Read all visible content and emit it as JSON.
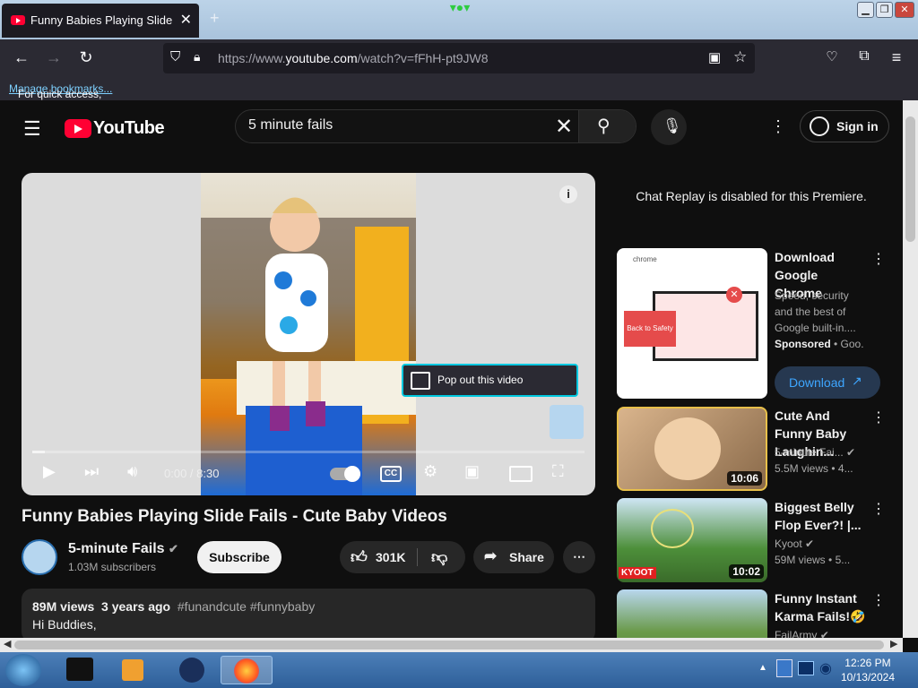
{
  "browser": {
    "tab_title": "Funny Babies Playing Slide Fails",
    "url_prefix": "https://www.",
    "url_domain": "youtube.com",
    "url_path": "/watch?v=fFhH-pt9JW8",
    "bookmarks_prompt": "For quick access, place your bookmarks here on the bookmarks toolbar.",
    "bookmarks_link": "Manage bookmarks..."
  },
  "youtube": {
    "logo_text": "YouTube",
    "search_value": "5 minute fails",
    "sign_in": "Sign in",
    "player": {
      "popout_label": "Pop out this video",
      "time": "0:00 / 8:30"
    },
    "video": {
      "title": "Funny Babies Playing Slide Fails - Cute Baby Videos",
      "channel": "5-minute Fails",
      "subscribers": "1.03M subscribers",
      "subscribe": "Subscribe",
      "likes": "301K",
      "share": "Share",
      "views": "89M views",
      "age": "3 years ago",
      "tags": "#funandcute #funnybaby",
      "description": "Hi Buddies,"
    },
    "chat_note": "Chat Replay is disabled for this Premiere.",
    "sidebar": [
      {
        "title": "Download Google Chrome",
        "meta1": "Speed, security and the best of Google built-in....",
        "sponsored": "Sponsored",
        "meta2": "Goo...",
        "cta": "Download",
        "thumb_text": "Back to Safety",
        "brand": "chrome"
      },
      {
        "title": "Cute And Funny Baby Laughin...",
        "channel": "5-minute Fai...",
        "stats": "5.5M views",
        "stats2": "4...",
        "duration": "10:06"
      },
      {
        "title": "Biggest Belly Flop Ever?! |...",
        "channel": "Kyoot",
        "stats": "59M views",
        "stats2": "5...",
        "duration": "10:02",
        "badge": "KYOOT"
      },
      {
        "title": "Funny Instant Karma Fails!🤣",
        "channel": "FailArmy"
      }
    ]
  },
  "taskbar": {
    "time": "12:26 PM",
    "date": "10/13/2024"
  }
}
